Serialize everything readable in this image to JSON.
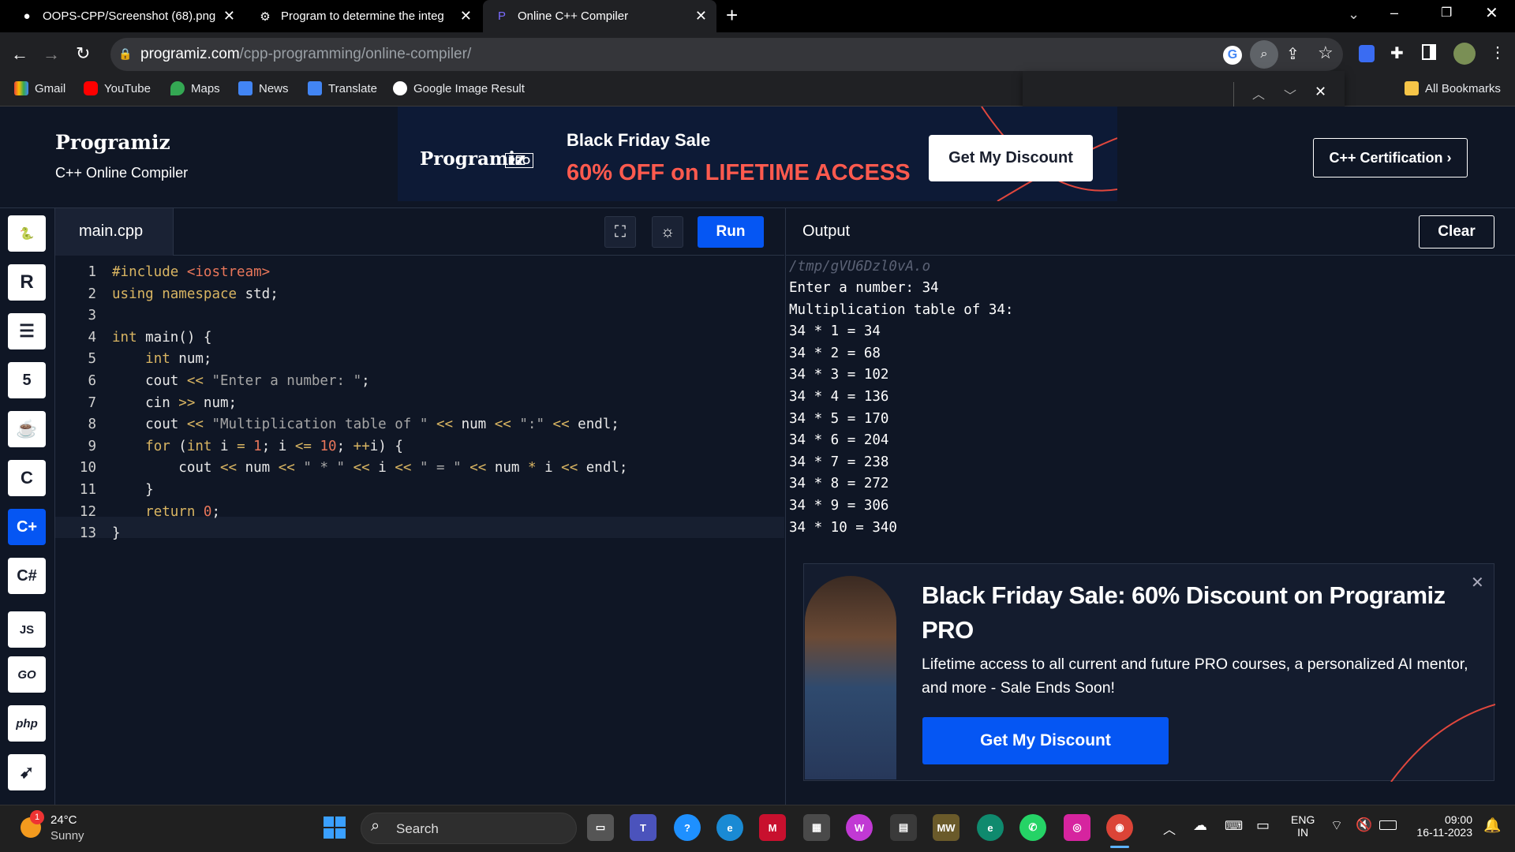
{
  "browser": {
    "tabs": [
      {
        "title": "OOPS-CPP/Screenshot (68).png",
        "active": false
      },
      {
        "title": "Program to determine the integ",
        "active": false
      },
      {
        "title": "Online C++ Compiler",
        "active": true
      }
    ],
    "url_host": "programiz.com",
    "url_path": "/cpp-programming/online-compiler/",
    "bookmarks": [
      "Gmail",
      "YouTube",
      "Maps",
      "News",
      "Translate",
      "Google Image Result"
    ],
    "all_bookmarks": "All Bookmarks"
  },
  "header": {
    "logo": "Programiz",
    "subtitle": "C++ Online Compiler",
    "certification_button": "C++ Certification ›"
  },
  "banner": {
    "logo": "Programiz",
    "pro_badge": "PRO",
    "headline": "Black Friday Sale",
    "offer": "60% OFF on LIFETIME ACCESS",
    "button": "Get My Discount"
  },
  "sidebar": {
    "languages": [
      "python",
      "r",
      "sql",
      "html",
      "java",
      "c",
      "cpp",
      "csharp",
      "js",
      "go",
      "php",
      "swift"
    ],
    "active": "cpp",
    "labels": {
      "js": "JS",
      "go": "GO",
      "php": "php"
    }
  },
  "editor": {
    "filename": "main.cpp",
    "run_label": "Run",
    "lines": [
      "#include <iostream>",
      "using namespace std;",
      "",
      "int main() {",
      "    int num;",
      "    cout << \"Enter a number: \";",
      "    cin >> num;",
      "    cout << \"Multiplication table of \" << num << \":\" << endl;",
      "    for (int i = 1; i <= 10; ++i) {",
      "        cout << num << \" * \" << i << \" = \" << num * i << endl;",
      "    }",
      "    return 0;",
      "}"
    ]
  },
  "output": {
    "title": "Output",
    "clear_label": "Clear",
    "path": "/tmp/gVU6Dzl0vA.o",
    "lines": [
      "Enter a number: 34",
      "Multiplication table of 34:",
      "34 * 1 = 34",
      "34 * 2 = 68",
      "34 * 3 = 102",
      "34 * 4 = 136",
      "34 * 5 = 170",
      "34 * 6 = 204",
      "34 * 7 = 238",
      "34 * 8 = 272",
      "34 * 9 = 306",
      "34 * 10 = 340"
    ]
  },
  "promo": {
    "title": "Black Friday Sale: 60% Discount on Programiz PRO",
    "body": "Lifetime access to all current and future PRO courses, a personalized AI mentor, and more - Sale Ends Soon!",
    "button": "Get My Discount"
  },
  "taskbar": {
    "weather_temp": "24°C",
    "weather_desc": "Sunny",
    "weather_badge": "1",
    "search": "Search",
    "lang_top": "ENG",
    "lang_bottom": "IN",
    "time": "09:00",
    "date": "16-11-2023"
  },
  "colors": {
    "accent": "#0556f3",
    "bg": "#0f1625",
    "offer": "#ff5a4e"
  }
}
